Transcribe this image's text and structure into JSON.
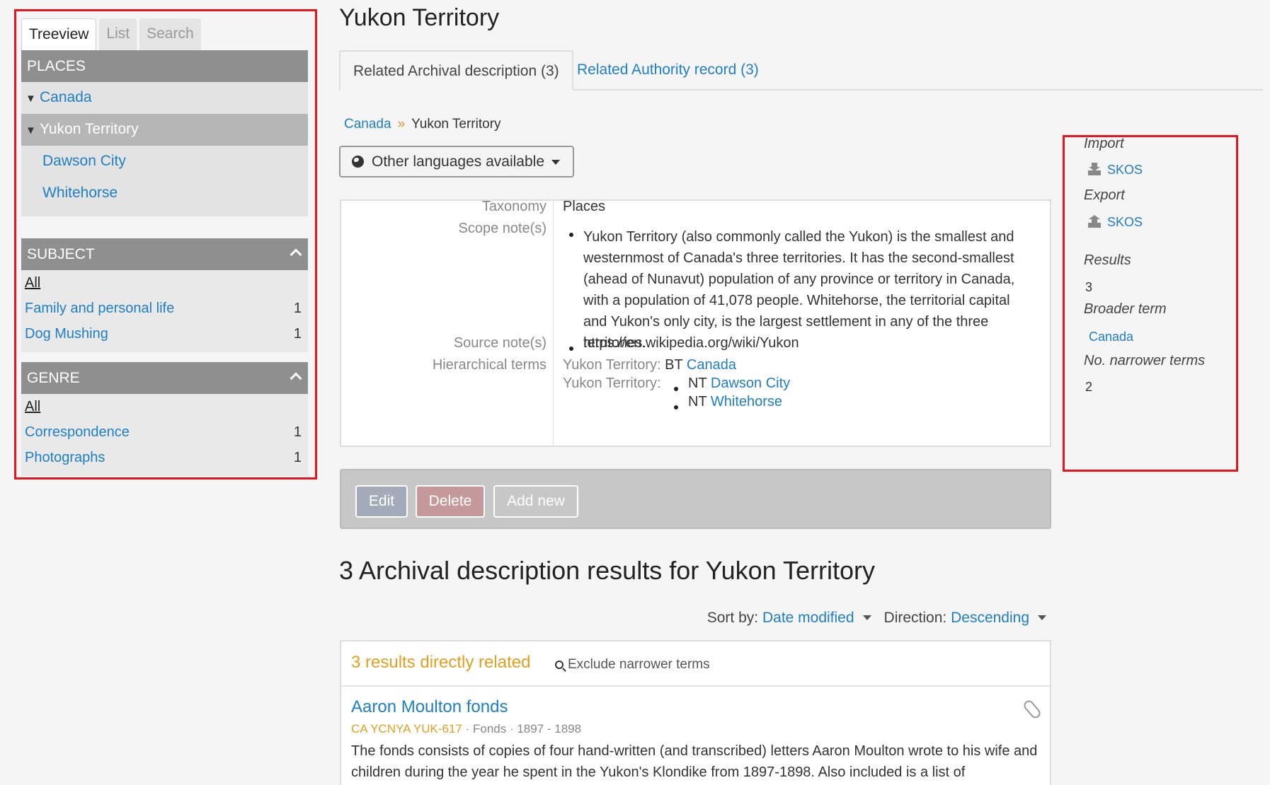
{
  "sidebar": {
    "tabs": [
      "Treeview",
      "List",
      "Search"
    ],
    "places": {
      "header": "PLACES",
      "items": [
        {
          "label": "Canada"
        },
        {
          "label": "Yukon Territory"
        },
        {
          "label": "Dawson City"
        },
        {
          "label": "Whitehorse"
        }
      ]
    },
    "subject": {
      "header": "SUBJECT",
      "all": "All",
      "items": [
        {
          "label": "Family and personal life",
          "count": "1"
        },
        {
          "label": "Dog Mushing",
          "count": "1"
        }
      ]
    },
    "genre": {
      "header": "GENRE",
      "all": "All",
      "items": [
        {
          "label": "Correspondence",
          "count": "1"
        },
        {
          "label": "Photographs",
          "count": "1"
        }
      ]
    }
  },
  "main": {
    "title": "Yukon Territory",
    "tabs": [
      "Related Archival description (3)",
      "Related Authority record (3)"
    ],
    "breadcrumb": {
      "parent": "Canada",
      "separator": "»",
      "current": "Yukon Territory"
    },
    "language_button": "Other languages available",
    "fields": {
      "taxonomy_label": "Taxonomy",
      "taxonomy_value": "Places",
      "scope_label": "Scope note(s)",
      "scope_value": "Yukon Territory (also commonly called the Yukon) is the smallest and westernmost of Canada's three territories. It has the second-smallest (ahead of Nunavut) population of any province or territory in Canada, with a population of 41,078 people. Whitehorse, the territorial capital and Yukon's only city, is the largest settlement in any of the three territories.",
      "source_label": "Source note(s)",
      "source_value": "https://en.wikipedia.org/wiki/Yukon",
      "hier_label": "Hierarchical terms",
      "bt_prefix": "Yukon Territory:",
      "bt_code": "BT",
      "bt_value": "Canada",
      "nt_prefix": "Yukon Territory:",
      "nt_code": "NT",
      "nt_values": [
        "Dawson City",
        "Whitehorse"
      ]
    },
    "actions": {
      "edit": "Edit",
      "delete": "Delete",
      "add": "Add new"
    },
    "results_title": "3 Archival description results for Yukon Territory",
    "sort": {
      "sort_label": "Sort by:",
      "sort_value": "Date modified",
      "dir_label": "Direction:",
      "dir_value": "Descending"
    },
    "results": {
      "direct": "3 results directly related",
      "exclude": "Exclude narrower terms",
      "item_title": "Aaron Moulton fonds",
      "item_ref": "CA YCNYA YUK-617",
      "item_level": "Fonds",
      "item_dates": "1897 - 1898",
      "item_desc": "The fonds consists of copies of four hand-written (and transcribed) letters Aaron Moulton wrote to his wife and children during the year he spent in the Yukon's Klondike from 1897-1898. Also included is a list of"
    }
  },
  "context": {
    "import_label": "Import",
    "import_link": "SKOS",
    "export_label": "Export",
    "export_link": "SKOS",
    "results_label": "Results",
    "results_value": "3",
    "broader_label": "Broader term",
    "broader_value": "Canada",
    "narrower_label": "No. narrower terms",
    "narrower_value": "2"
  },
  "colors": {
    "link": "#1f7fc4",
    "accent_orange": "#e0a020",
    "highlight_border": "#e8161c"
  }
}
